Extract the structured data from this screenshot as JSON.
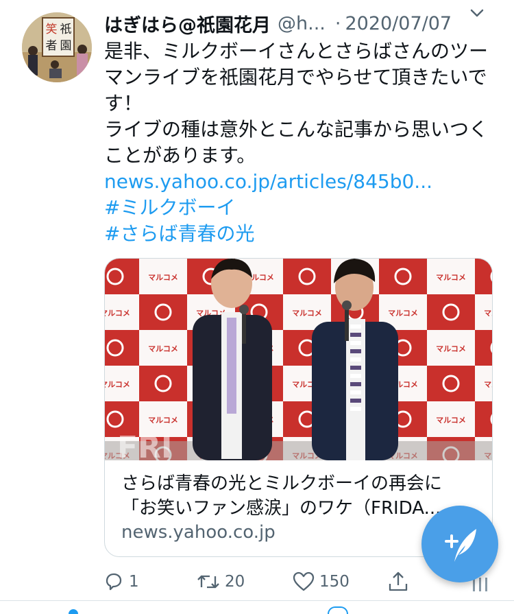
{
  "tweet": {
    "author_name": "はぎはら@祇園花月",
    "handle": "@h...",
    "separator": "·",
    "date": "2020/07/07",
    "text_lines": [
      "是非、ミルクボーイさんとさらばさんのツー",
      "マンライブを祇園花月でやらせて頂きたいで",
      "す！",
      "ライブの種は意外とこんな記事から思いつく",
      "ことがあります。"
    ],
    "link_url": "news.yahoo.co.jp/articles/845b0...",
    "hashtags": [
      "#ミルクボーイ",
      "#さらば青春の光"
    ],
    "avatar_sign": "笑祇者園"
  },
  "card": {
    "image_brand_text": "マルコメ",
    "image_watermark": "FRI",
    "title_lines": [
      "さらば青春の光とミルクボーイの再会に",
      "「お笑いファン感涙」のワケ（FRIDA..."
    ],
    "domain": "news.yahoo.co.jp"
  },
  "actions": {
    "reply_count": "1",
    "retweet_count": "20",
    "like_count": "150"
  },
  "colors": {
    "link": "#1d9bf0",
    "fab": "#4a9fe8",
    "backdrop_red": "#c9302c"
  },
  "icons": {
    "reply": "reply-icon",
    "retweet": "retweet-icon",
    "like": "heart-icon",
    "share": "share-icon",
    "compose": "compose-tweet-icon",
    "more": "chevron-down-icon"
  }
}
